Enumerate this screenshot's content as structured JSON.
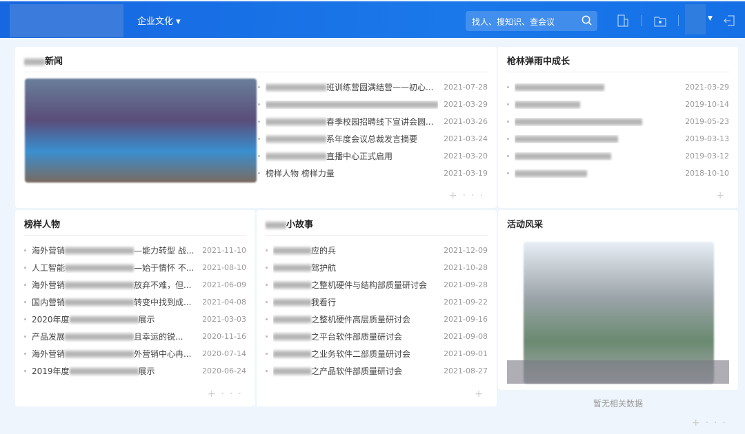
{
  "header": {
    "menu": "企业文化",
    "search_placeholder": "找人、搜知识、查会议"
  },
  "news": {
    "title": "新闻",
    "items": [
      {
        "text": "班训练营圆满结营——初心...",
        "date": "2021-07-28"
      },
      {
        "text": "",
        "date": "2021-03-29"
      },
      {
        "text": "春季校园招聘线下宣讲会圆...",
        "date": "2021-03-26"
      },
      {
        "text": "系年度会议总裁发言摘要",
        "date": "2021-03-24"
      },
      {
        "text": "直播中心正式启用",
        "date": "2021-03-20"
      },
      {
        "text": "榜样人物 榜样力量",
        "date": "2021-03-19"
      }
    ]
  },
  "growth": {
    "title": "枪林弹雨中成长",
    "dates": [
      "2021-03-29",
      "2019-10-14",
      "2019-05-23",
      "2019-03-13",
      "2019-03-12",
      "2018-10-10"
    ]
  },
  "models": {
    "title": "榜样人物",
    "items": [
      {
        "pre": "海外营销",
        "post": "—能力转型 战...",
        "date": "2021-11-10"
      },
      {
        "pre": "人工智能",
        "post": "—始于情怀 不...",
        "date": "2021-08-10"
      },
      {
        "pre": "海外营销",
        "post": "放弃不难，但...",
        "date": "2021-06-09"
      },
      {
        "pre": "国内营销",
        "post": "转变中找到成...",
        "date": "2021-04-08"
      },
      {
        "pre": "2020年度",
        "post": "展示",
        "date": "2021-03-03"
      },
      {
        "pre": "产品发展",
        "post": "且幸运的锐...",
        "date": "2020-11-16"
      },
      {
        "pre": "海外营销",
        "post": "外营销中心冉...",
        "date": "2020-07-14"
      },
      {
        "pre": "2019年度",
        "post": "展示",
        "date": "2020-06-24"
      }
    ]
  },
  "stories": {
    "title": "小故事",
    "items": [
      {
        "text": "应的兵",
        "date": "2021-12-09"
      },
      {
        "text": "驾护航",
        "date": "2021-10-28"
      },
      {
        "text": "之整机硬件与结构部质量研讨会",
        "date": "2021-09-28"
      },
      {
        "text": "我看行",
        "date": "2021-09-22"
      },
      {
        "text": "之整机硬件高层质量研讨会",
        "date": "2021-09-16"
      },
      {
        "text": "之平台软件部质量研讨会",
        "date": "2021-09-08"
      },
      {
        "text": "之业务软件二部质量研讨会",
        "date": "2021-09-01"
      },
      {
        "text": "之产品软件部质量研讨会",
        "date": "2021-08-27"
      }
    ]
  },
  "activity": {
    "title": "活动风采",
    "empty": "暂无相关数据"
  },
  "foot": {
    "plus": "+",
    "more": "···"
  }
}
